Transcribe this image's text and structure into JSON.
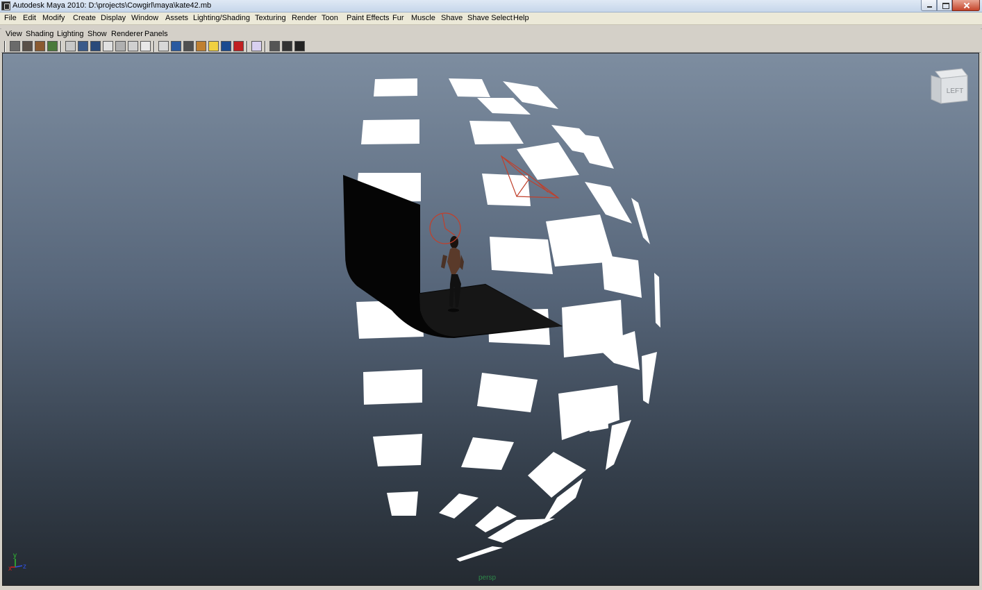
{
  "window": {
    "title": "Autodesk Maya 2010: D:\\projects\\Cowgirl\\maya\\kate42.mb"
  },
  "menubar": {
    "items": [
      "File",
      "Edit",
      "Modify",
      "Create",
      "Display",
      "Window",
      "Assets",
      "Lighting/Shading",
      "Texturing",
      "Render",
      "Toon",
      "Paint Effects",
      "Fur",
      "Muscle",
      "Shave",
      "Shave Select",
      "Help"
    ]
  },
  "panel_menu": {
    "items": [
      "View",
      "Shading",
      "Lighting",
      "Show",
      "Renderer",
      "Panels"
    ]
  },
  "toolbar": {
    "icons": [
      "select-camera-icon",
      "camera-attributes-icon",
      "bookmark-icon",
      "image-plane-icon",
      "grid-icon",
      "film-gate-icon",
      "resolution-gate-icon",
      "gate-mask-icon",
      "field-chart-icon",
      "safe-action-icon",
      "safe-title-icon",
      "wireframe-icon",
      "smooth-shade-icon",
      "flat-shade-icon",
      "textured-icon",
      "use-lights-icon",
      "shadows-icon",
      "xray-icon",
      "isolate-select-icon",
      "frame-all-icon",
      "frame-selection-icon",
      "resolution-icon"
    ]
  },
  "viewport": {
    "camera_label": "persp",
    "viewcube_label": "LEFT",
    "axis_labels": {
      "x": "x",
      "y": "y",
      "z": "z"
    }
  },
  "colors": {
    "menu_bg": "#ece9d8",
    "panel_bg": "#d4d0c8",
    "viewport_top": "#7d8da0",
    "viewport_bottom": "#242a31",
    "camera_label": "#2e8a4a",
    "light_manipulator": "#c0402c"
  }
}
